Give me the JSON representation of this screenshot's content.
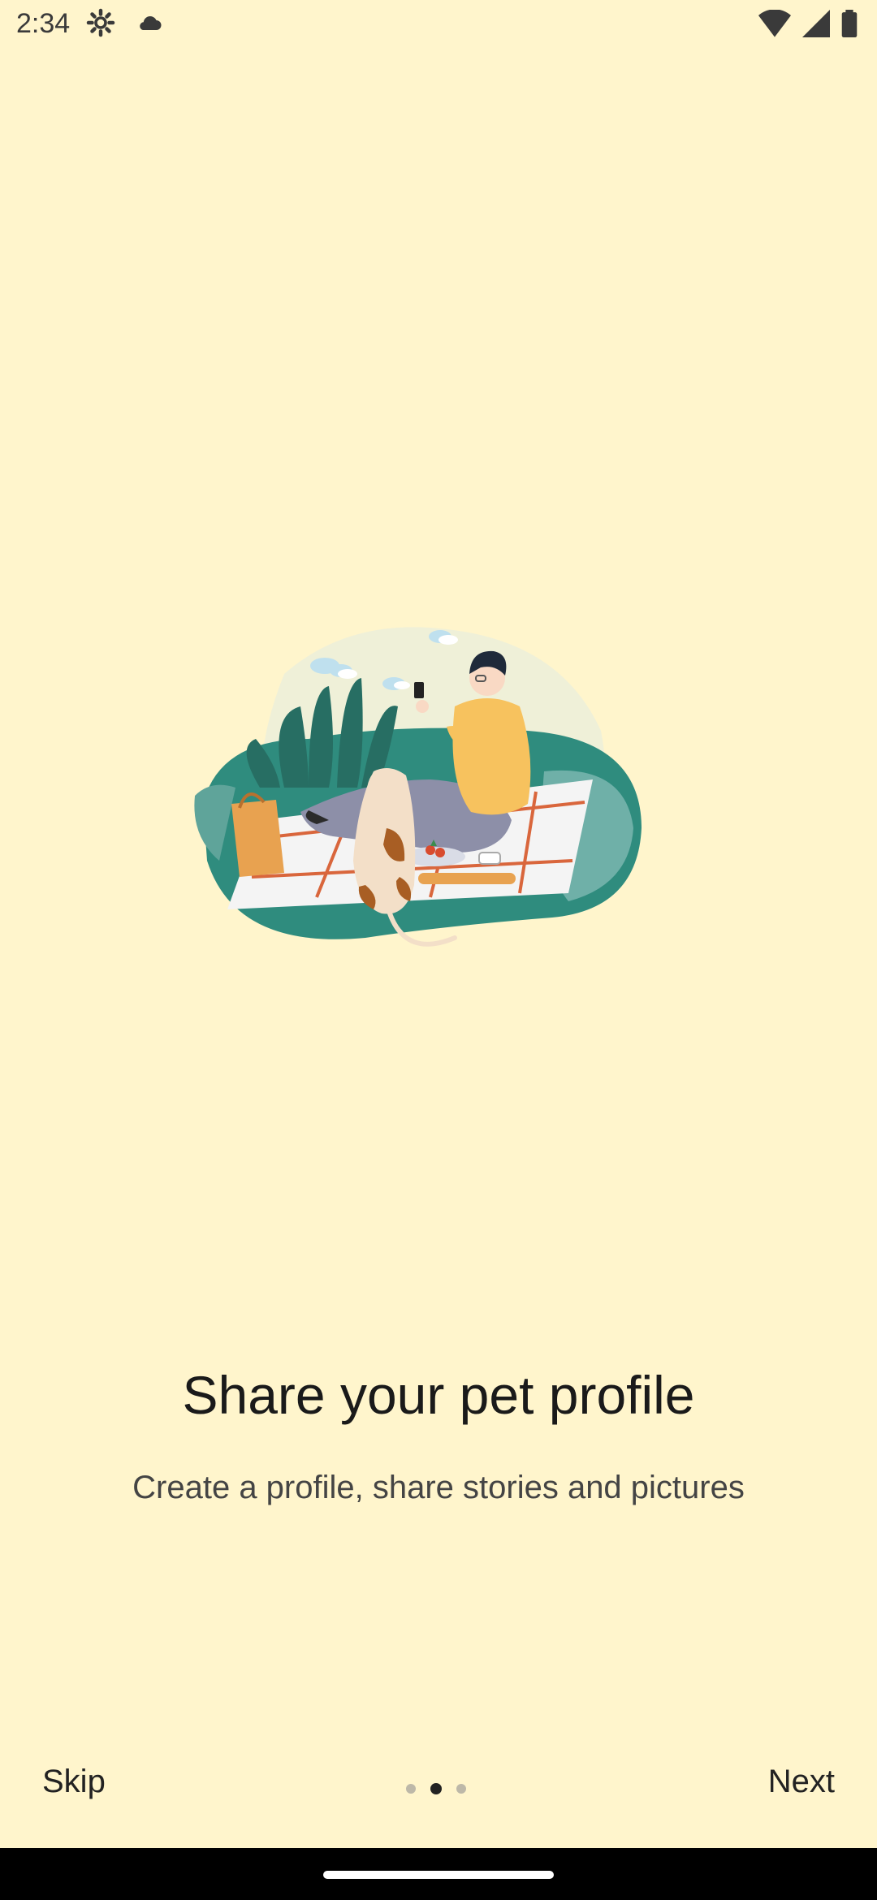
{
  "status_bar": {
    "time": "2:34",
    "icons_left": [
      "settings-icon",
      "cloud-icon"
    ],
    "icons_right": [
      "wifi-icon",
      "signal-icon",
      "battery-icon"
    ]
  },
  "illustration": {
    "name": "person-with-dog-picnic-illustration"
  },
  "onboarding": {
    "title": "Share your pet profile",
    "subtitle": "Create a profile, share stories and pictures",
    "page_index": 2,
    "page_count": 3
  },
  "bottom_bar": {
    "skip_label": "Skip",
    "next_label": "Next"
  },
  "colors": {
    "background": "#FFF5CC",
    "text_primary": "#1a1a1a",
    "teal": "#2F8C7E",
    "accent_orange": "#F2B35C"
  }
}
